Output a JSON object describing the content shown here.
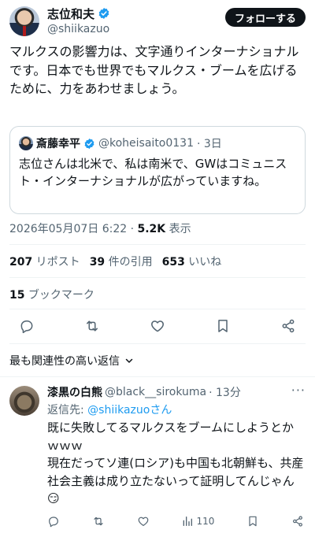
{
  "author": {
    "name": "志位和夫",
    "handle": "@shiikazuo",
    "follow_label": "フォローする"
  },
  "tweet": {
    "text": "マルクスの影響力は、文字通りインターナショナルです。日本でも世界でもマルクス・ブームを広げるために、力をあわせましょう。"
  },
  "quote": {
    "name": "斎藤幸平",
    "handle": "@koheisaito0131",
    "time": "· 3日",
    "text": "志位さんは北米で、私は南米で、GWはコミュニスト・インターナショナルが広がっていますね。"
  },
  "timestamp": {
    "datetime": "2026年05月07日 6:22 · ",
    "views_count": "5.2K",
    "views_label": " 表示"
  },
  "stats": {
    "reposts_count": "207",
    "reposts_label": " リポスト",
    "quotes_count": "39",
    "quotes_label": " 件の引用",
    "likes_count": "653",
    "likes_label": " いいね"
  },
  "bookmarks": {
    "count": "15",
    "label": " ブックマーク"
  },
  "sort": {
    "label": "最も関連性の高い返信"
  },
  "reply": {
    "name": "漆黒の白熊",
    "handle": "@black__sirokuma",
    "time": "· 13分",
    "reply_to_label": "返信先: ",
    "reply_to_handle": "@shiikazuoさん",
    "text": "既に失敗してるマルクスをブームにしようとかｗｗｗ\n現在だってソ連(ロシア)も中国も北朝鮮も、共産社会主義は成り立たないって証明してんじゃん😏",
    "views": "110"
  },
  "colors": {
    "accent": "#1d9bf0",
    "text": "#0f1419",
    "secondary": "#536471",
    "border": "#cfd9de"
  },
  "icons": [
    "verified-badge-icon",
    "reply-icon",
    "repost-icon",
    "like-icon",
    "bookmark-icon",
    "share-icon",
    "chevron-down-icon",
    "views-icon",
    "more-icon"
  ]
}
